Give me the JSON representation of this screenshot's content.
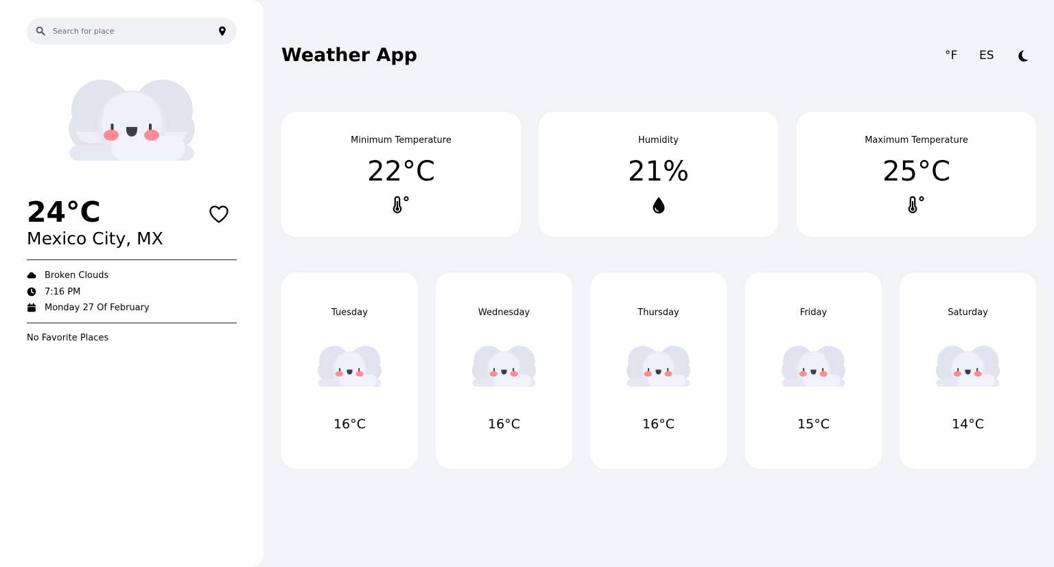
{
  "app": {
    "title": "Weather App"
  },
  "search": {
    "placeholder": "Search for place"
  },
  "current": {
    "temperature": "24°C",
    "location": "Mexico City, MX",
    "condition": "Broken Clouds",
    "time": "7:16 PM",
    "date": "Monday 27 Of February",
    "icon": "cloud-face-icon"
  },
  "favorites": {
    "empty_text": "No Favorite Places"
  },
  "toolbar": {
    "unit_toggle": "°F",
    "language_toggle": "ES",
    "theme_icon": "moon-icon"
  },
  "stats": [
    {
      "label": "Minimum Temperature",
      "value": "22°C",
      "icon": "thermometer-icon"
    },
    {
      "label": "Humidity",
      "value": "21%",
      "icon": "droplet-icon"
    },
    {
      "label": "Maximum Temperature",
      "value": "25°C",
      "icon": "thermometer-icon"
    }
  ],
  "forecast": [
    {
      "day": "Tuesday",
      "temp": "16°C",
      "icon": "cloud-face-icon"
    },
    {
      "day": "Wednesday",
      "temp": "16°C",
      "icon": "cloud-face-icon"
    },
    {
      "day": "Thursday",
      "temp": "16°C",
      "icon": "cloud-face-icon"
    },
    {
      "day": "Friday",
      "temp": "15°C",
      "icon": "cloud-face-icon"
    },
    {
      "day": "Saturday",
      "temp": "14°C",
      "icon": "cloud-face-icon"
    }
  ],
  "colors": {
    "background": "#f2f3f5",
    "card": "#ffffff",
    "cloud_back": "#e1e4ef",
    "cloud_front": "#eef0f9",
    "cheek": "#ff8a95",
    "face": "#3c3f4a"
  }
}
